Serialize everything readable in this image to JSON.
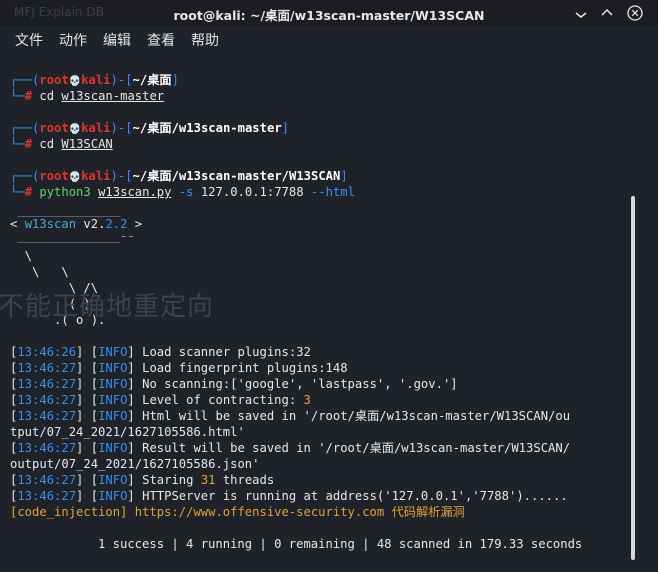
{
  "window": {
    "title": "root@kali: ~/桌面/w13scan-master/W13SCAN",
    "ghost_text": "MFJ   Explain DB"
  },
  "menu": [
    "文件",
    "动作",
    "编辑",
    "查看",
    "帮助"
  ],
  "prompts": [
    {
      "user": "root",
      "skull": "💀",
      "host": "kali",
      "path": "~/桌面",
      "cmd": "cd",
      "arg": "w13scan-master",
      "rest": ""
    },
    {
      "user": "root",
      "skull": "💀",
      "host": "kali",
      "path": "~/桌面/w13scan-master",
      "cmd": "cd",
      "arg": "W13SCAN",
      "rest": ""
    },
    {
      "user": "root",
      "skull": "💀",
      "host": "kali",
      "path": "~/桌面/w13scan-master/W13SCAN",
      "cmd": "python3",
      "arg": "w13scan.py",
      "rest_flag": "-s",
      "rest_value": "127.0.0.1:7788",
      "rest_flag2": "--html"
    }
  ],
  "banner": {
    "top": " ______________",
    "name": "w13scan",
    "version_prefix": "v",
    "version_major": "2",
    "version_dot": ".",
    "version_minor": "2.2",
    "bottom": " ______________--",
    "art1": "  \\",
    "art2": "   \\   \\",
    "art3": "        \\ /\\",
    "art4": "        ( )",
    "art5": "      .( o )."
  },
  "watermark": "不能正确地重定向",
  "log": [
    {
      "time": "13:46:26",
      "level": "INFO",
      "msg": "Load scanner plugins:32"
    },
    {
      "time": "13:46:27",
      "level": "INFO",
      "msg": "Load fingerprint plugins:148"
    },
    {
      "time": "13:46:27",
      "level": "INFO",
      "msg": "No scanning:['google', 'lastpass', '.gov.']"
    },
    {
      "time": "13:46:27",
      "level": "INFO",
      "msg_pre": "Level of contracting: ",
      "msg_num": "3"
    },
    {
      "time": "13:46:27",
      "level": "INFO",
      "msg": "Html will be saved in '/root/桌面/w13scan-master/W13SCAN/ou"
    },
    {
      "continuation": "tput/07_24_2021/1627105586.html'"
    },
    {
      "time": "13:46:27",
      "level": "INFO",
      "msg": "Result will be saved in '/root/桌面/w13scan-master/W13SCAN/"
    },
    {
      "continuation": "output/07_24_2021/1627105586.json'"
    },
    {
      "time": "13:46:27",
      "level": "INFO",
      "msg_pre": "Staring ",
      "msg_num": "31",
      "msg_post": " threads"
    },
    {
      "time": "13:46:27",
      "level": "INFO",
      "msg": "HTTPServer is running at address('127.0.0.1','7788')......"
    }
  ],
  "finding": {
    "tag": "[code_injection]",
    "url": "https://www.offensive-security.com",
    "note": "代码解析漏洞"
  },
  "status": "1 success | 4 running | 0 remaining | 48 scanned in 179.33 seconds"
}
